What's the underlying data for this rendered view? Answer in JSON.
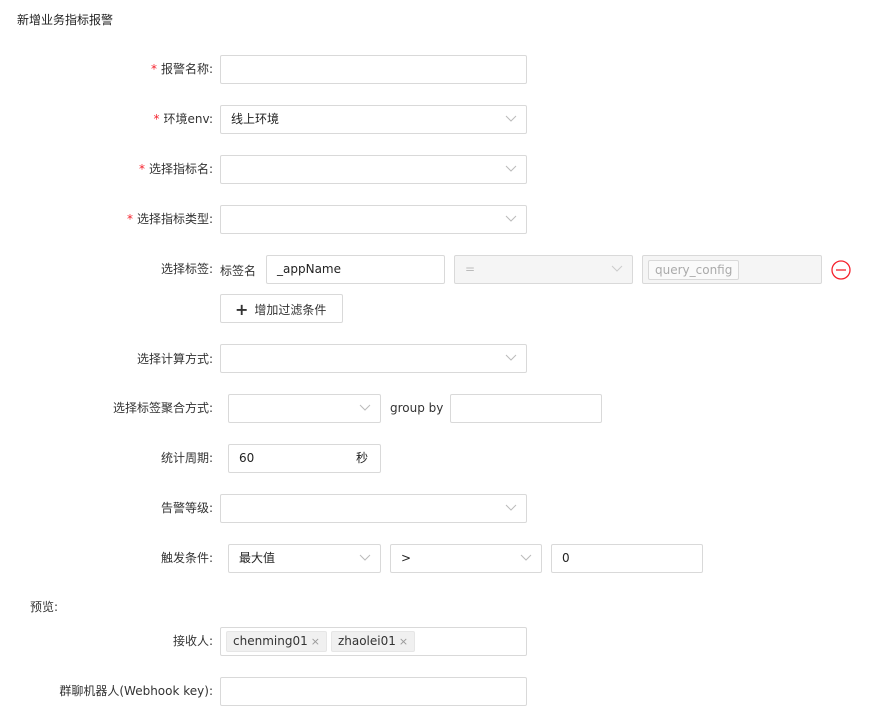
{
  "page_title": "新增业务指标报警",
  "form": {
    "alert_name_label": "报警名称:",
    "env_label": "环境env:",
    "env_value": "线上环境",
    "metric_name_label": "选择指标名:",
    "metric_type_label": "选择指标类型:",
    "tag_label": "选择标签:",
    "tag_key_label": "标签名",
    "tag_key_value": "_appName",
    "tag_op_value": "=",
    "tag_value_chip": "query_config",
    "add_filter_label": "增加过滤条件",
    "calc_label": "选择计算方式:",
    "agg_label": "选择标签聚合方式:",
    "group_by_label": "group by",
    "period_label": "统计周期:",
    "period_value": "60",
    "period_unit": "秒",
    "level_label": "告警等级:",
    "trigger_label": "触发条件:",
    "trigger_func_value": "最大值",
    "trigger_op_value": ">",
    "trigger_threshold_value": "0"
  },
  "preview": {
    "section_label": "预览:",
    "receivers_label": "接收人:",
    "receivers": [
      "chenming01",
      "zhaolei01"
    ],
    "webhook_label": "群聊机器人(Webhook key):"
  },
  "icons": {
    "required_mark": "*",
    "tag_close": "×",
    "remove_icon_color": "#f5222d"
  }
}
